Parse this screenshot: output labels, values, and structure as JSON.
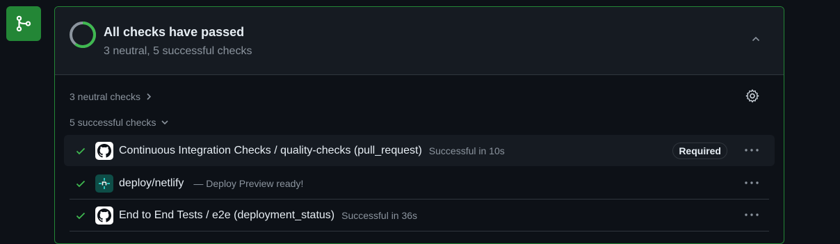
{
  "summary": {
    "title": "All checks have passed",
    "subtitle": "3 neutral, 5 successful checks"
  },
  "sections": {
    "neutral_label": "3 neutral checks",
    "successful_label": "5 successful checks"
  },
  "checks": [
    {
      "icon": "github-icon",
      "name": "Continuous Integration Checks / quality-checks (pull_request)",
      "status": "Successful in 10s",
      "badge": "Required"
    },
    {
      "icon": "netlify-icon",
      "name": "deploy/netlify",
      "status": "— Deploy Preview ready!"
    },
    {
      "icon": "github-icon",
      "name": "End to End Tests / e2e (deployment_status)",
      "status": "Successful in 36s"
    }
  ],
  "colors": {
    "success": "#3fb950",
    "accent_green": "#238636",
    "muted": "#8b949e",
    "background": "#0d1117"
  }
}
